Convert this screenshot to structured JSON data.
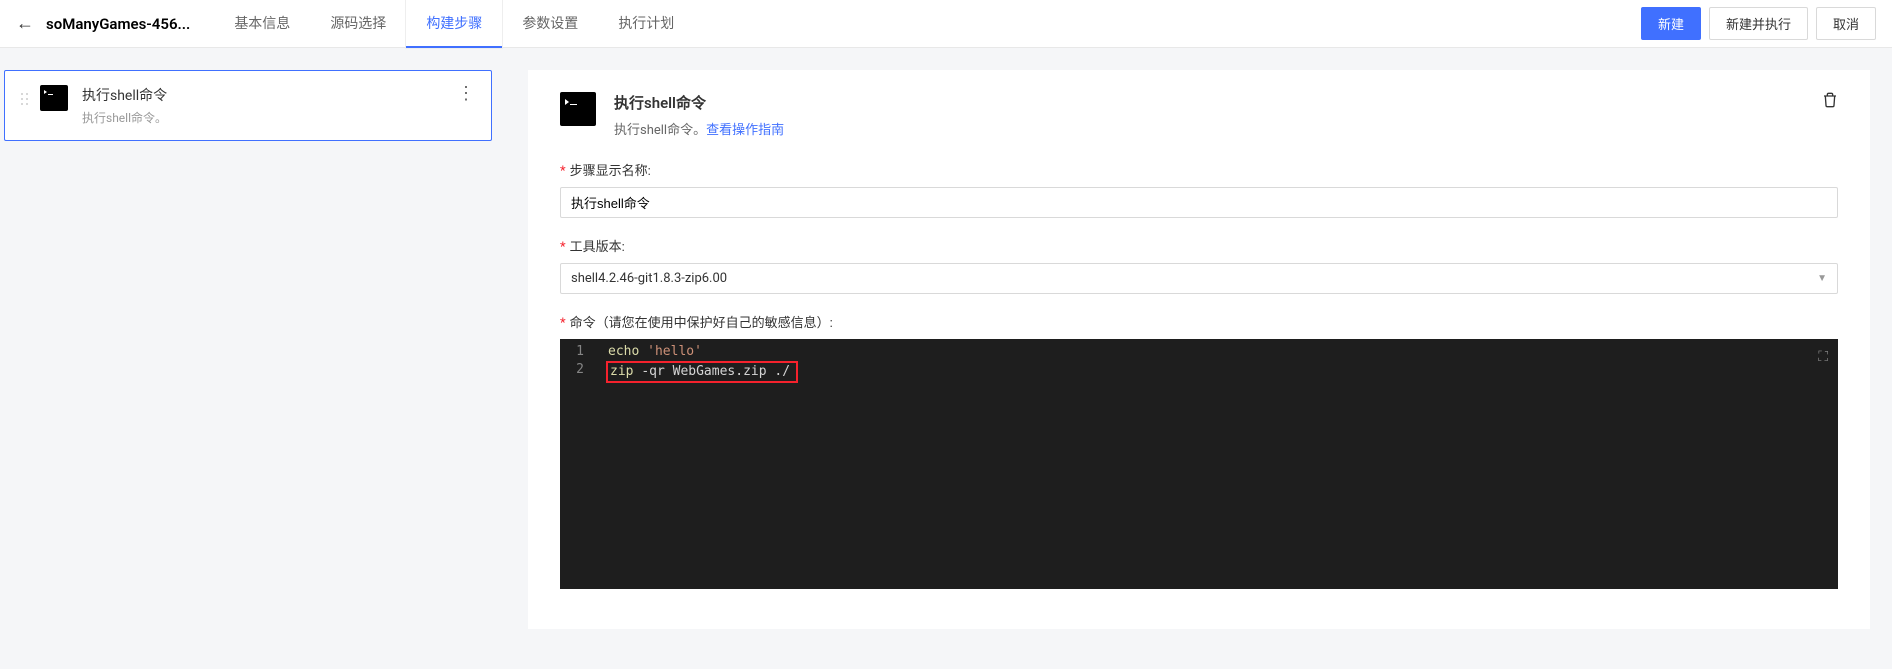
{
  "header": {
    "title": "soManyGames-456...",
    "tabs": [
      {
        "label": "基本信息"
      },
      {
        "label": "源码选择"
      },
      {
        "label": "构建步骤",
        "active": true
      },
      {
        "label": "参数设置"
      },
      {
        "label": "执行计划"
      }
    ],
    "actions": {
      "create": "新建",
      "createAndRun": "新建并执行",
      "cancel": "取消"
    }
  },
  "sidebar": {
    "step": {
      "title": "执行shell命令",
      "desc": "执行shell命令。"
    }
  },
  "detail": {
    "title": "执行shell命令",
    "desc_prefix": "执行shell命令。",
    "desc_link": "查看操作指南",
    "form": {
      "stepNameLabel": "步骤显示名称:",
      "stepNameValue": "执行shell命令",
      "toolVersionLabel": "工具版本:",
      "toolVersionValue": "shell4.2.46-git1.8.3-zip6.00",
      "commandLabel": "命令（请您在使用中保护好自己的敏感信息）:",
      "code": {
        "lines": [
          {
            "num": "1",
            "tokens": [
              {
                "t": "echo ",
                "c": "cmd"
              },
              {
                "t": "'hello'",
                "c": "str"
              }
            ],
            "highlighted": false
          },
          {
            "num": "2",
            "tokens": [
              {
                "t": "zip ",
                "c": "cmd"
              },
              {
                "t": "-qr ",
                "c": "flag"
              },
              {
                "t": "WebGames.zip ./",
                "c": "flag"
              }
            ],
            "highlighted": true
          }
        ]
      }
    }
  }
}
